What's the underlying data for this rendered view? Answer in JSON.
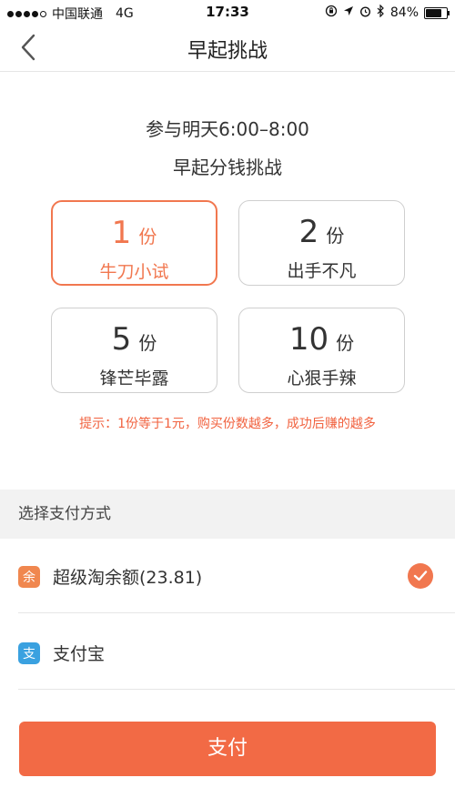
{
  "status_bar": {
    "carrier": "中国联通",
    "network": "4G",
    "time": "17:33",
    "battery": "84%",
    "battery_level": 0.84,
    "icons": [
      "signal-dots-icon",
      "lock-rotation-icon",
      "location-arrow-icon",
      "alarm-icon",
      "bluetooth-icon",
      "battery-icon"
    ]
  },
  "nav": {
    "title": "早起挑战",
    "back_icon": "chevron-left-icon"
  },
  "heading": {
    "line1": "参与明天6:00–8:00",
    "line2": "早起分钱挑战"
  },
  "options": [
    {
      "count": "1",
      "unit": "份",
      "name": "牛刀小试",
      "selected": true
    },
    {
      "count": "2",
      "unit": "份",
      "name": "出手不凡",
      "selected": false
    },
    {
      "count": "5",
      "unit": "份",
      "name": "锋芒毕露",
      "selected": false
    },
    {
      "count": "10",
      "unit": "份",
      "name": "心狠手辣",
      "selected": false
    }
  ],
  "hint": "提示：1份等于1元，购买份数越多，成功后赚的越多",
  "payment": {
    "section_title": "选择支付方式",
    "methods": [
      {
        "icon_char": "余",
        "label": "超级淘余额(23.81)",
        "selected": true,
        "icon_color": "#f0874f"
      },
      {
        "icon_char": "支",
        "label": "支付宝",
        "selected": false,
        "icon_color": "#3aa1e0"
      }
    ]
  },
  "pay_button": "支付",
  "colors": {
    "accent": "#f1774f",
    "button": "#f26a45",
    "hint": "#f1623f"
  }
}
